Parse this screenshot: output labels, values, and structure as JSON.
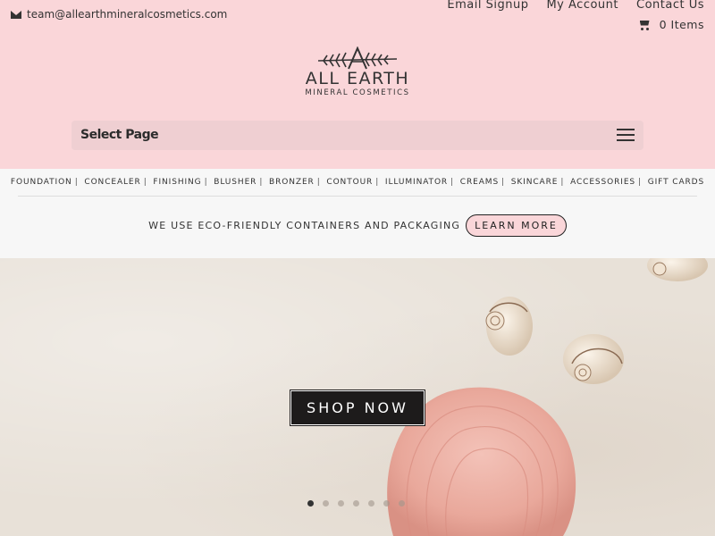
{
  "topbar": {
    "email": "team@allearthmineralcosmetics.com",
    "links": [
      "Email Signup",
      "My Account",
      "Contact Us"
    ],
    "cart_label": "0 Items"
  },
  "logo": {
    "name": "ALL EARTH",
    "subtitle": "MINERAL COSMETICS"
  },
  "menu": {
    "select_label": "Select Page"
  },
  "categories": [
    "FOUNDATION",
    "CONCEALER",
    "FINISHING",
    "BLUSHER",
    "BRONZER",
    "CONTOUR",
    "ILLUMINATOR",
    "CREAMS",
    "SKINCARE",
    "ACCESSORIES",
    "GIFT CARDS"
  ],
  "promo": {
    "text": "WE USE ECO-FRIENDLY CONTAINERS AND PACKAGING",
    "button": "LEARN MORE"
  },
  "hero": {
    "button": "SHOP NOW",
    "slide_count": 7,
    "active_slide": 1
  },
  "colors": {
    "header_bg": "#fad6d9",
    "band_bg": "#f7f7f7",
    "dark": "#1d1b1b"
  }
}
